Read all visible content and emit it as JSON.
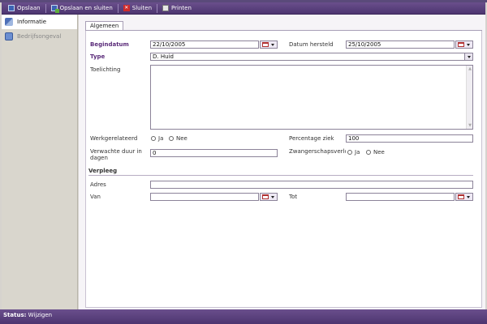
{
  "toolbar": {
    "save_label": "Opslaan",
    "save_close_label": "Opslaan en sluiten",
    "close_label": "Sluiten",
    "print_label": "Printen"
  },
  "sidebar": {
    "items": [
      {
        "label": "Informatie",
        "icon": "information-icon",
        "active": true
      },
      {
        "label": "Bedrijfsongeval",
        "icon": "document-icon",
        "active": false
      }
    ]
  },
  "tabs": [
    {
      "label": "Algemeen"
    }
  ],
  "form": {
    "begindatum": {
      "label": "Begindatum",
      "value": "22/10/2005"
    },
    "datum_hersteld": {
      "label": "Datum hersteld",
      "value": "25/10/2005"
    },
    "type": {
      "label": "Type",
      "value": "D. Huid"
    },
    "toelichting": {
      "label": "Toelichting",
      "value": ""
    },
    "werkgerelateerd": {
      "label": "Werkgerelateerd",
      "options": [
        "Ja",
        "Nee"
      ]
    },
    "percentage_ziek": {
      "label": "Percentage ziek",
      "value": "100"
    },
    "verwachte_duur": {
      "label": "Verwachte duur in dagen",
      "value": "0"
    },
    "zwangerschap": {
      "label": "Zwangerschapsverlc",
      "options": [
        "Ja",
        "Nee"
      ]
    }
  },
  "verpleeg": {
    "title": "Verpleeg",
    "adres": {
      "label": "Adres",
      "value": ""
    },
    "van": {
      "label": "Van",
      "value": ""
    },
    "tot": {
      "label": "Tot",
      "value": ""
    }
  },
  "status": {
    "label": "Status:",
    "value": "Wijzigen"
  },
  "colors": {
    "accent": "#5b3f80",
    "label_bold": "#5b2c7a"
  }
}
